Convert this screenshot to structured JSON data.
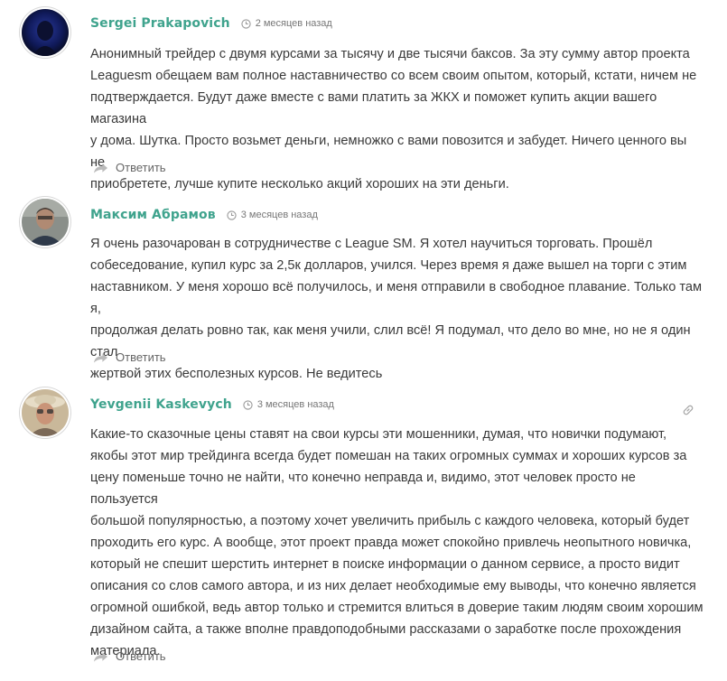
{
  "comments": [
    {
      "author": "Sergei Prakapovich",
      "time": "2 месяцев назад",
      "lines": [
        "Анонимный трейдер с двумя курсами за тысячу и две тысячи баксов. За эту сумму автор проекта",
        "Leaguesm обещаем вам полное наставничество со всем своим опытом, который, кстати, ничем не",
        "подтверждается. Будут даже вместе с вами платить за ЖКХ и поможет купить акции вашего магазина",
        "у дома. Шутка. Просто возьмет деньги, немножко с вами повозится и забудет. Ничего ценного вы не",
        "приобретете, лучше купите несколько акций хороших на эти деньги."
      ],
      "reply_label": "Ответить"
    },
    {
      "author": "Максим Абрамов",
      "time": "3 месяцев назад",
      "lines": [
        "Я очень разочарован в сотрудничестве с League SM. Я хотел научиться торговать. Прошёл",
        "собеседование, купил курс за 2,5к долларов, учился. Через время я даже вышел на торги с этим",
        "наставником. У меня хорошо всё получилось, и меня отправили в свободное плавание. Только там я,",
        "продолжая делать ровно так, как меня учили, слил всё! Я подумал, что дело во мне, но не я один стал",
        "жертвой этих бесполезных курсов. Не ведитесь"
      ],
      "reply_label": "Ответить"
    },
    {
      "author": "Yevgenii Kaskevych",
      "time": "3 месяцев назад",
      "lines": [
        "Какие-то сказочные цены ставят на свои курсы эти мошенники, думая, что новички подумают,",
        "якобы этот мир трейдинга всегда будет помешан на таких огромных суммах и хороших курсов за",
        "цену поменьше точно не найти, что конечно неправда и, видимо, этот человек просто не пользуется",
        "большой популярностью, а поэтому хочет увеличить прибыль с каждого человека, который будет",
        "проходить его курс. А вообще, этот проект правда может спокойно привлечь неопытного новичка,",
        "который не спешит шерстить интернет в поиске информации о данном сервисе, а просто видит",
        "описания со слов самого автора, и из них делает необходимые ему выводы, что конечно является",
        "огромной ошибкой, ведь автор только и стремится влиться в доверие таким людям своим хорошим",
        "дизайном сайта, а также вполне правдоподобными рассказами о заработке после прохождения",
        "материала."
      ],
      "reply_label": "Ответить"
    }
  ],
  "icons": {
    "clock": "clock-icon",
    "reply": "reply-arrow-icon",
    "permalink": "link-icon"
  },
  "colors": {
    "author": "#3fa38d",
    "text": "#3a3a3a",
    "muted": "#777777"
  }
}
